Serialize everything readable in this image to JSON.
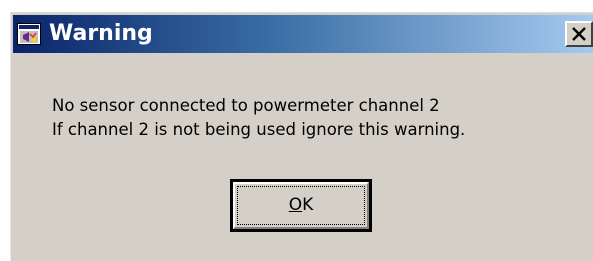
{
  "window": {
    "title": "Warning",
    "icon": "labview-app-icon",
    "close_icon": "close-icon",
    "title_gradient_start": "#0a246a",
    "title_gradient_end": "#a6caf0",
    "body_color": "#d4d0c8"
  },
  "message": {
    "line1": "No sensor connected to powermeter channel 2",
    "line2": "If channel 2 is not being used ignore this warning."
  },
  "buttons": {
    "ok_mnemonic": "O",
    "ok_rest": "K"
  }
}
